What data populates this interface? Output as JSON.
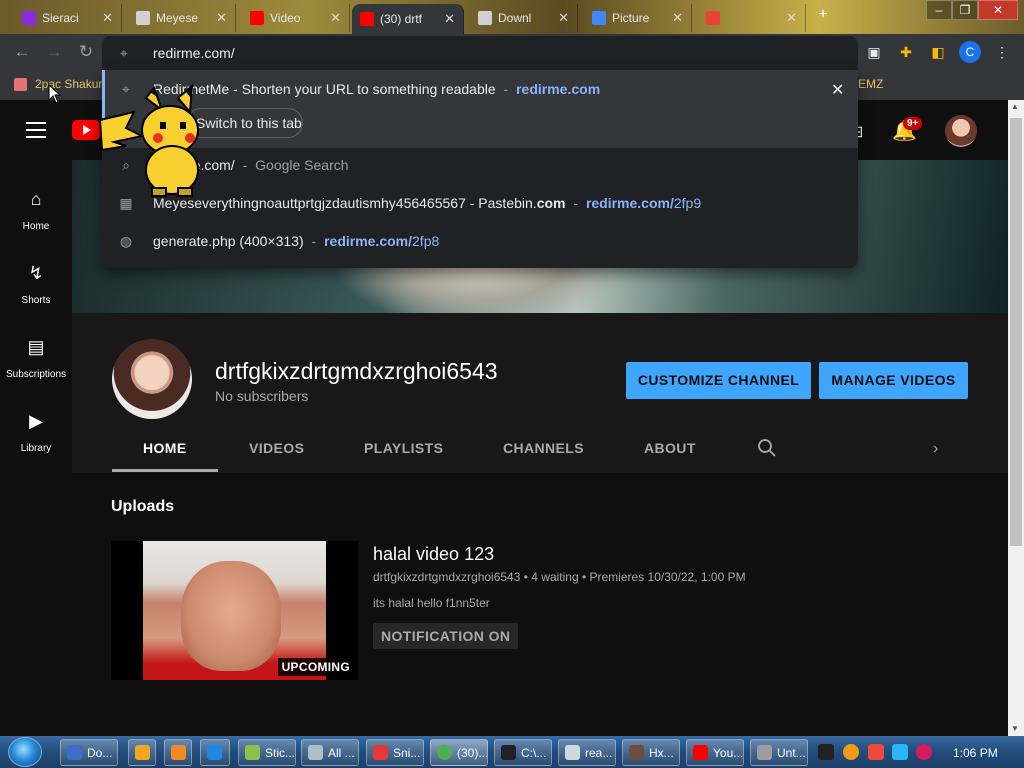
{
  "browser": {
    "tabs": [
      {
        "label": "Sieraci",
        "color": "#8a2be2"
      },
      {
        "label": "Meyese",
        "color": "#d0d0d0"
      },
      {
        "label": "Video",
        "color": "#ff0000"
      },
      {
        "label": "(30) drtf",
        "color": "#ff0000"
      },
      {
        "label": "Downl",
        "color": "#d0d0d0"
      },
      {
        "label": "Picture",
        "color": "#4285f4"
      },
      {
        "label": "",
        "color": "#ea4335"
      }
    ],
    "new_tab_glyph": "+",
    "address": "redirme.com/",
    "profile_initial": "C",
    "bookmarks": [
      {
        "label": "2pac Shakur"
      },
      {
        "label": "EMZ"
      }
    ]
  },
  "omnibox_dropdown": {
    "selected": {
      "title": "RedirmetMe - Shorten your URL to something readable",
      "separator": "-",
      "domain": "redirme.com",
      "switch_label": "Switch to this tab"
    },
    "rows": [
      {
        "icon": "search-icon",
        "text": "redirme.com/",
        "sep": "-",
        "hint": "Google Search"
      },
      {
        "icon": "pastebin-icon",
        "text": "Meyeseverythingnoauttprtgjzdautismhy456465567 - Pastebin.",
        "bold": "com",
        "sep": "-",
        "domain": "redirme.com/",
        "path": "2fp9"
      },
      {
        "icon": "globe-icon",
        "text": "generate.php (400×313)",
        "sep": "-",
        "domain": "redirme.com/",
        "path": "2fp8"
      }
    ]
  },
  "youtube": {
    "notifications": "9+",
    "sidebar": [
      {
        "icon": "home-icon",
        "label": "Home"
      },
      {
        "icon": "shorts-icon",
        "label": "Shorts"
      },
      {
        "icon": "subscriptions-icon",
        "label": "Subscriptions"
      },
      {
        "icon": "library-icon",
        "label": "Library"
      }
    ],
    "channel": {
      "name": "drtfgkixzdrtgmdxzrghoi6543",
      "subscribers": "No subscribers",
      "customize_label": "CUSTOMIZE CHANNEL",
      "manage_label": "MANAGE VIDEOS"
    },
    "tabs": [
      "HOME",
      "VIDEOS",
      "PLAYLISTS",
      "CHANNELS",
      "ABOUT"
    ],
    "uploads": {
      "title": "Uploads",
      "video": {
        "title": "halal video 123",
        "meta": "drtfgkixzdrtgmdxzrghoi6543 • 4 waiting • Premieres 10/30/22, 1:00 PM",
        "description": "its halal hello f1nn5ter",
        "badge": "UPCOMING",
        "notify_label": "NOTIFICATION ON"
      }
    }
  },
  "taskbar": {
    "items": [
      {
        "label": "Do...",
        "color": "#3b6fc7"
      },
      {
        "label": "",
        "color": "#f5a623"
      },
      {
        "label": "",
        "color": "#f08a24"
      },
      {
        "label": "",
        "color": "#1e88e5"
      },
      {
        "label": "Stic...",
        "color": "#8bc34a"
      },
      {
        "label": "All ...",
        "color": "#b0bec5"
      },
      {
        "label": "Sni...",
        "color": "#e53935"
      },
      {
        "label": "(30)...",
        "color": "#4caf50"
      },
      {
        "label": "C:\\...",
        "color": "#212121"
      },
      {
        "label": "rea...",
        "color": "#cfd8dc"
      },
      {
        "label": "Hx...",
        "color": "#6d4c41"
      },
      {
        "label": "You...",
        "color": "#ff0000"
      },
      {
        "label": "Unt...",
        "color": "#9e9e9e"
      }
    ],
    "clock": "1:06 PM"
  }
}
